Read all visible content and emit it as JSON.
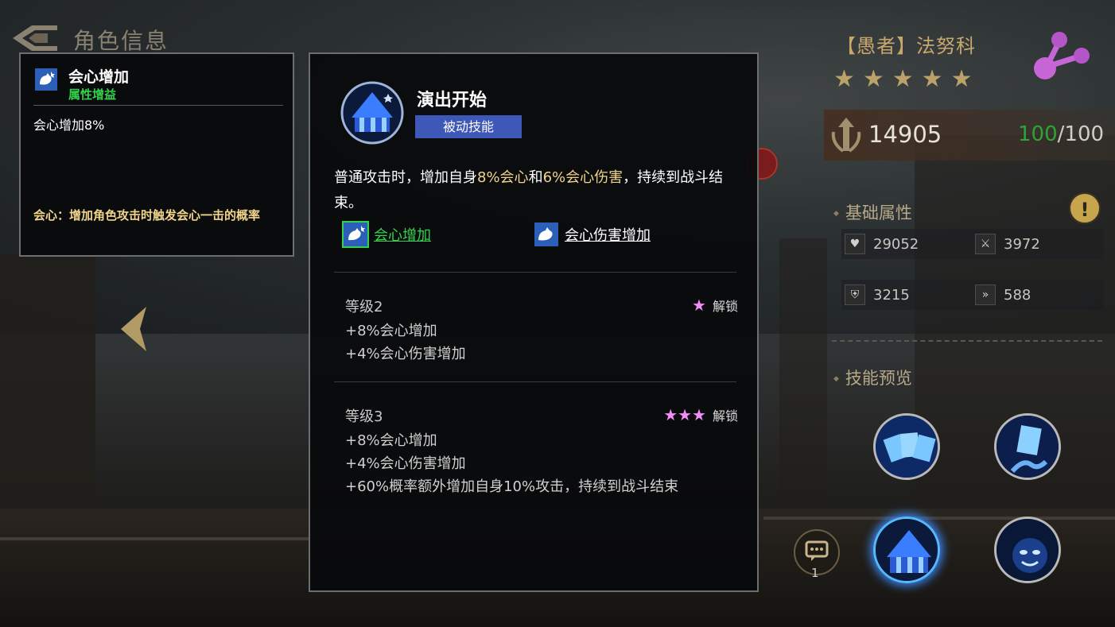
{
  "header": {
    "title": "角色信息"
  },
  "tooltip": {
    "name": "会心增加",
    "category": "属性增益",
    "value": "会心增加8%",
    "note": "会心：增加角色攻击时触发会心一击的概率"
  },
  "skill": {
    "name": "演出开始",
    "type": "被动技能",
    "desc_pre": "普通攻击时，增加自身",
    "desc_hl1": "8%会心",
    "desc_mid": "和",
    "desc_hl2": "6%会心伤害",
    "desc_post": "，持续到战斗结束。",
    "link1": "会心增加",
    "link2": "会心伤害增加",
    "levels": [
      {
        "title": "等级2",
        "unlock_stars": "★",
        "unlock_label": "解锁",
        "bonuses": [
          "+8%会心增加",
          "+4%会心伤害增加"
        ]
      },
      {
        "title": "等级3",
        "unlock_stars": "★★★",
        "unlock_label": "解锁",
        "bonuses": [
          "+8%会心增加",
          "+4%会心伤害增加",
          "+60%概率额外增加自身10%攻击，持续到战斗结束"
        ]
      }
    ]
  },
  "hero": {
    "name": "【愚者】法努科",
    "stars": "★★★★★",
    "power": "14905",
    "stamina_current": "100",
    "stamina_max": "/100"
  },
  "sections": {
    "basic": "基础属性",
    "skills": "技能预览"
  },
  "stats": {
    "hp": "29052",
    "attack": "3972",
    "defense": "3215",
    "speed": "588"
  },
  "chat": {
    "count": "1"
  },
  "colors": {
    "accent_green": "#34d24a",
    "highlight_gold": "#f1d58a",
    "skill_type_bg": "#3d58b7",
    "star_pink": "#f58cf7"
  }
}
